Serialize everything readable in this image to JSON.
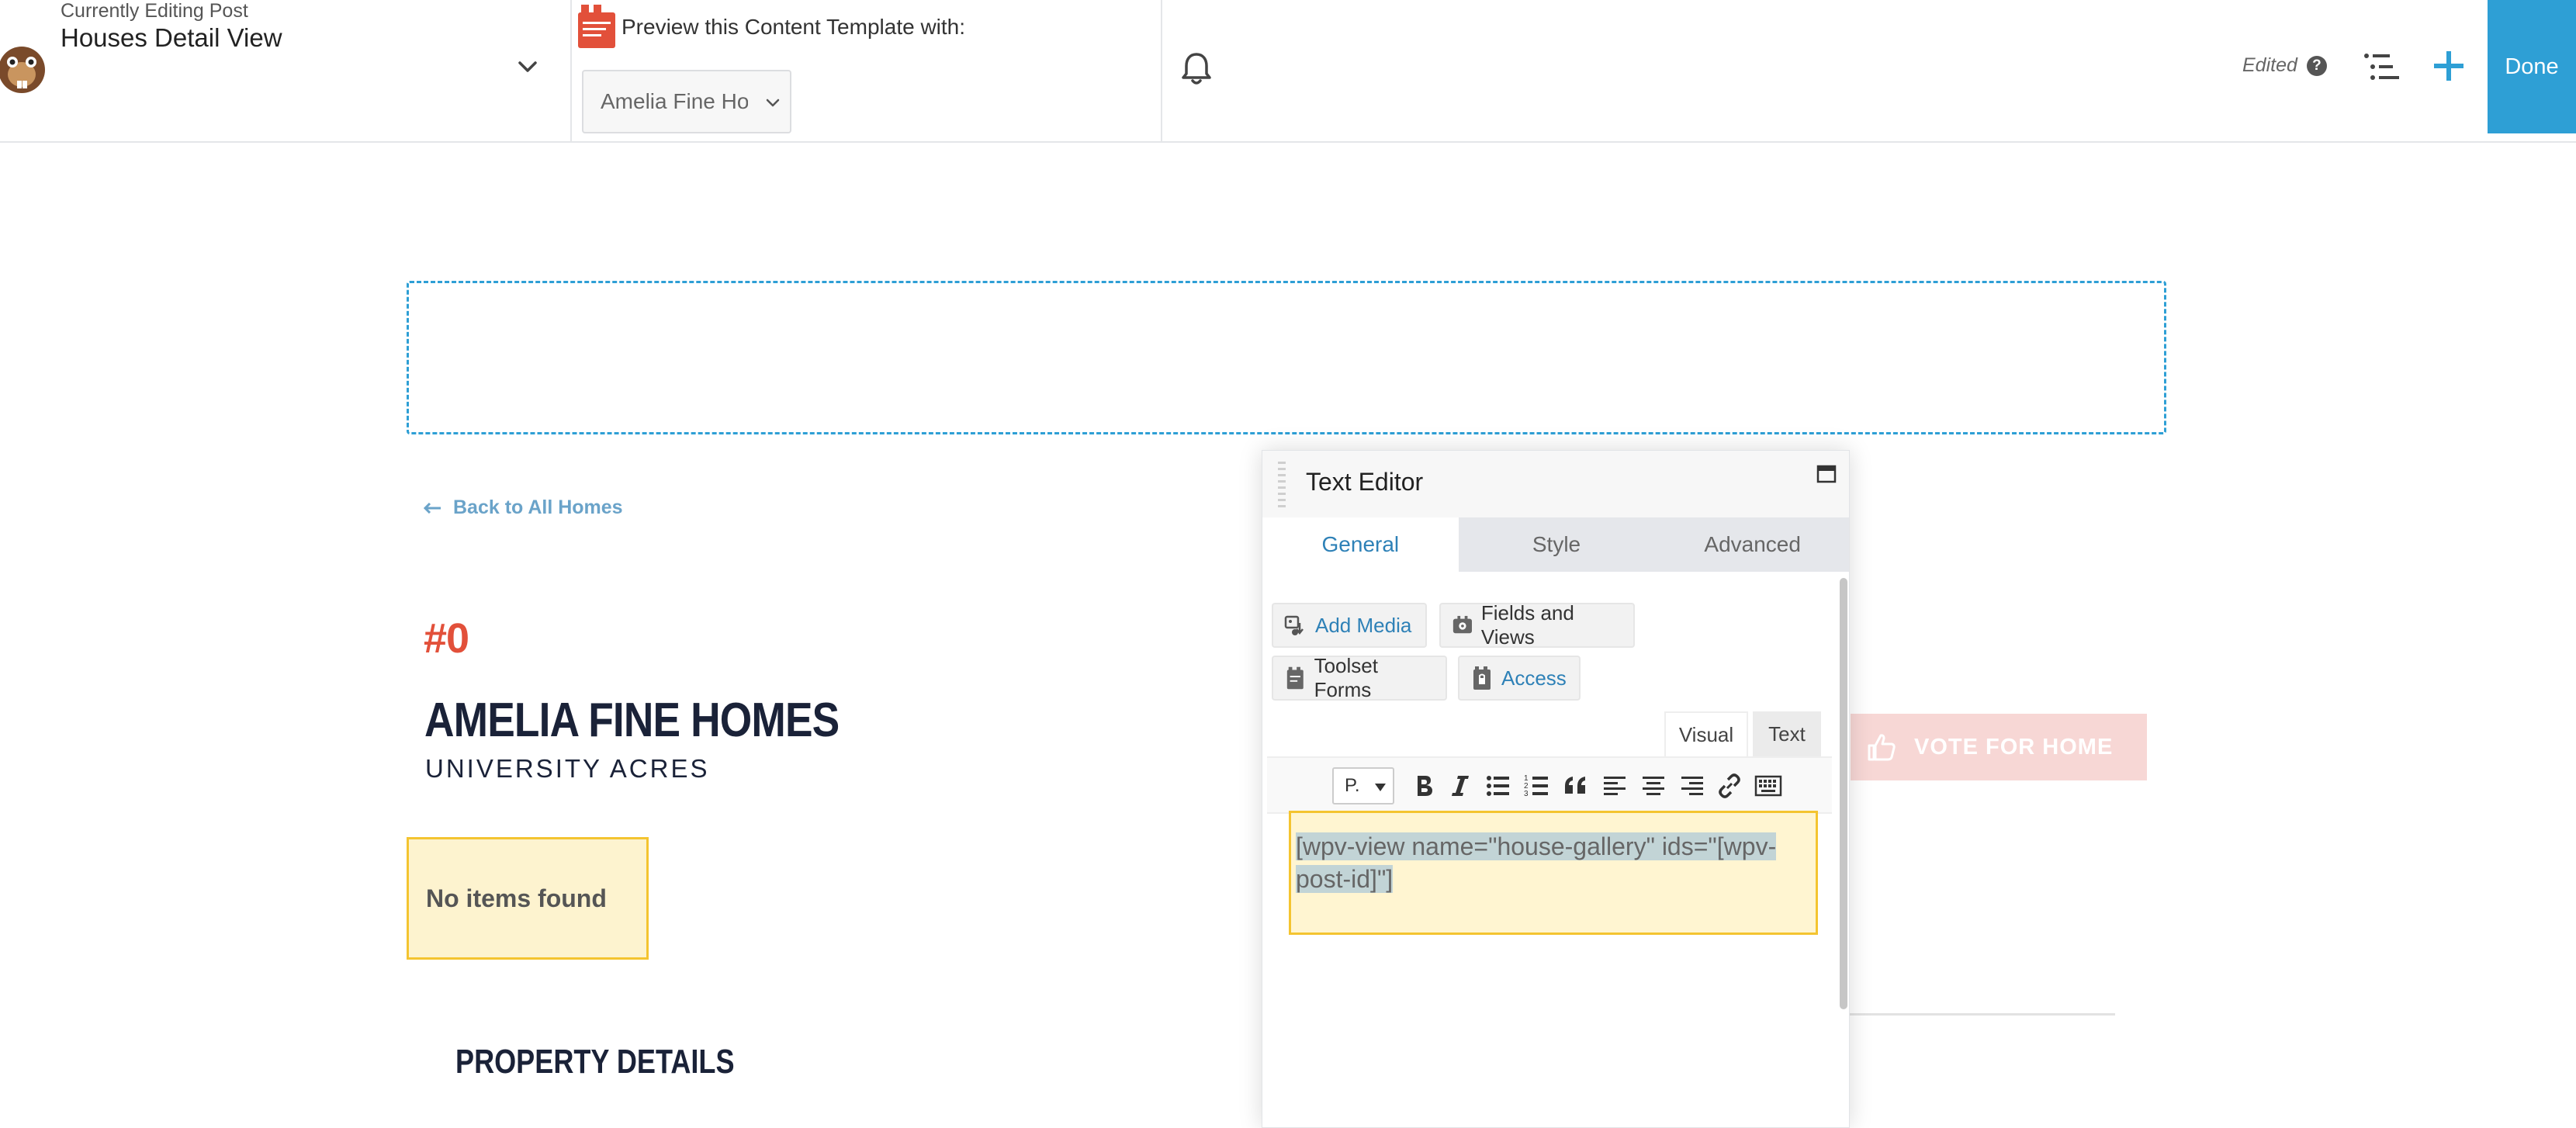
{
  "header": {
    "editing_label": "Currently Editing Post",
    "post_title": "Houses Detail View",
    "preview_label": "Preview this Content Template with:",
    "preview_value": "Amelia Fine Homes",
    "edited_label": "Edited",
    "done_label": "Done"
  },
  "page": {
    "back_link": "Back to All Homes",
    "house_number": "#0",
    "house_title": "AMELIA FINE HOMES",
    "house_subtitle": "UNIVERSITY ACRES",
    "no_items": "No items found",
    "property_details": "PROPERTY DETAILS",
    "vote_button": "VOTE FOR HOME"
  },
  "panel": {
    "title": "Text Editor",
    "tabs": [
      "General",
      "Style",
      "Advanced"
    ],
    "active_tab": "General",
    "buttons": {
      "add_media": "Add Media",
      "fields_and_views": "Fields and Views",
      "toolset_forms": "Toolset Forms",
      "access": "Access"
    },
    "mode_tabs": {
      "visual": "Visual",
      "text": "Text"
    },
    "format_select": "P.",
    "content": "[wpv-view name=\"house-gallery\" ids=\"[wpv-post-id]\"]"
  },
  "colors": {
    "accent": "#2e9fd5",
    "link": "#2e81b7",
    "brand_red": "#e2503a",
    "title_navy": "#1a2238",
    "highlight_yellow": "#fdf3cf",
    "highlight_border": "#f4c430"
  },
  "icons": {
    "logo": "beaver-logo-icon",
    "post_menu": "chevron-down-icon",
    "toolset": "toolset-logo-icon",
    "notifications": "bell-icon",
    "help": "help-circle-icon",
    "outline": "outline-list-icon",
    "add": "plus-icon",
    "back": "arrow-left-icon",
    "vote": "thumbs-up-icon"
  }
}
